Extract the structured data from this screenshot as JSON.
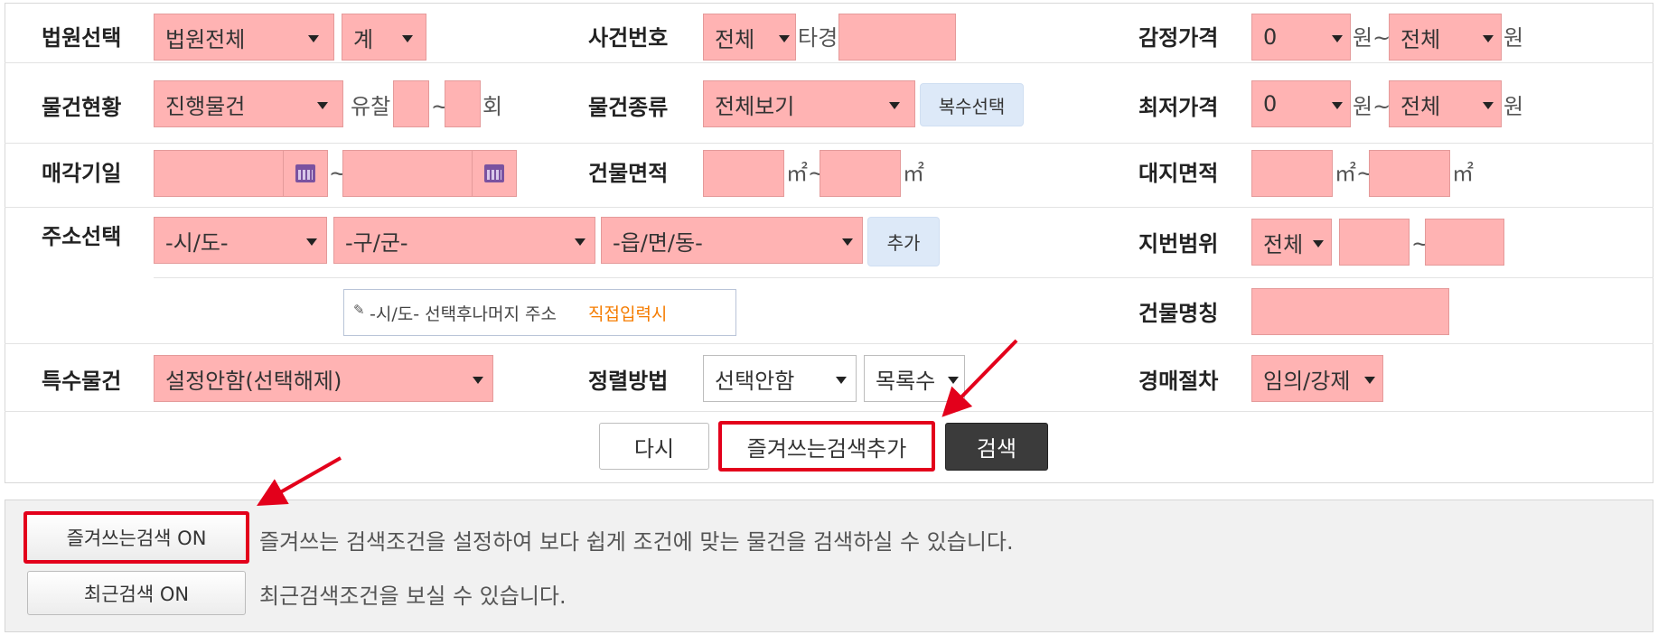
{
  "labels": {
    "court_select": "법원선택",
    "case_number": "사건번호",
    "appraisal_price": "감정가격",
    "item_status": "물건현황",
    "item_type": "물건종류",
    "min_price": "최저가격",
    "sale_date": "매각기일",
    "building_area": "건물면적",
    "land_area": "대지면적",
    "address_select": "주소선택",
    "lot_range": "지번범위",
    "building_name": "건물명칭",
    "special_item": "특수물건",
    "sort_method": "정렬방법",
    "auction_procedure": "경매절차"
  },
  "values": {
    "court": "법원전체",
    "court_sub": "계",
    "case_year": "전체",
    "case_other": "타경",
    "appraisal_min": "0",
    "appraisal_max": "전체",
    "won": "원",
    "won_tilde": "원~",
    "status": "진행물건",
    "fail_prefix": "유찰",
    "tilde": "~",
    "times": "회",
    "type": "전체보기",
    "multi_select": "복수선택",
    "min_price_min": "0",
    "min_price_max": "전체",
    "sqm": "㎡",
    "sqm_tilde": "㎡~",
    "sido": "-시/도-",
    "gugun": "-구/군-",
    "dong": "-읍/면/동-",
    "add": "추가",
    "lot_all": "전체",
    "address_hint_prefix": "-시/도- 선택후나머지 주소",
    "address_hint_link": "직접입력시",
    "special": "설정안함(선택해제)",
    "sort": "선택안함",
    "list_count": "목록수",
    "procedure": "임의/강제"
  },
  "buttons": {
    "reset": "다시",
    "add_favorite": "즐겨쓰는검색추가",
    "search": "검색",
    "favorite_on": "즐겨쓰는검색 ON",
    "recent_on": "최근검색 ON"
  },
  "descriptions": {
    "favorite": "즐겨쓰는 검색조건을 설정하여 보다 쉽게 조건에 맞는 물건을 검색하실 수 있습니다.",
    "recent": "최근검색조건을 보실 수 있습니다."
  },
  "colors": {
    "field": "#ffb3b3",
    "highlight": "#e3001b",
    "search_button": "#3b3b3b",
    "link": "#f57c00"
  }
}
